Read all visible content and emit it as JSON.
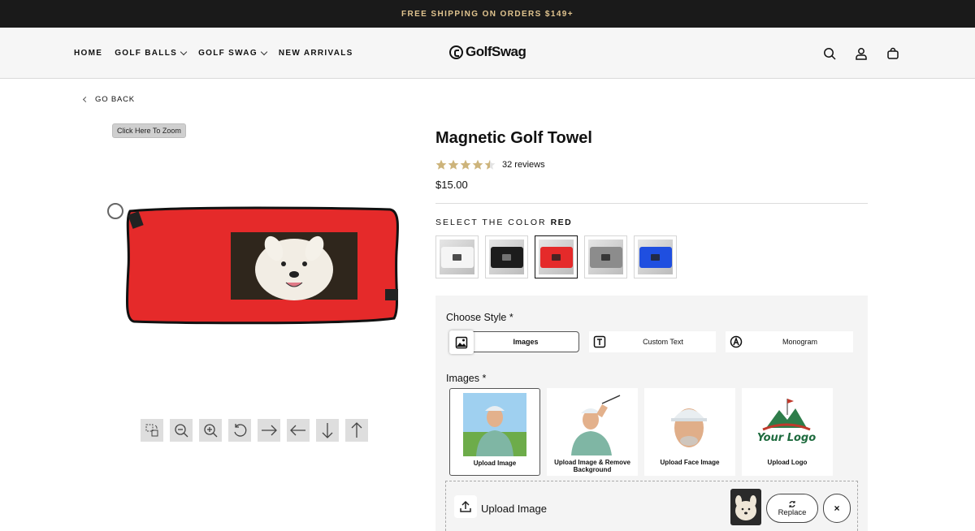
{
  "announcement": "FREE SHIPPING ON ORDERS $149+",
  "nav": {
    "home": "HOME",
    "golf_balls": "GOLF BALLS",
    "golf_swag": "GOLF SWAG",
    "new_arrivals": "NEW ARRIVALS"
  },
  "logo": "GolfSwag",
  "header_icons": [
    "search-icon",
    "account-icon",
    "cart-icon"
  ],
  "go_back": "GO BACK",
  "zoom_hint": "Click Here To Zoom",
  "product": {
    "title": "Magnetic Golf Towel",
    "rating": 4.5,
    "reviews": "32 reviews",
    "price": "$15.00",
    "color_label": "SELECT THE COLOR",
    "selected_color": "RED",
    "colors": [
      {
        "color": "#f5f5f5"
      },
      {
        "color": "#1c1c1c"
      },
      {
        "color": "#e52a2a"
      },
      {
        "color": "#8c8c8c"
      },
      {
        "color": "#1f4fe0"
      }
    ],
    "selected_index": 2
  },
  "style": {
    "label": "Choose Style *",
    "options": {
      "images": "Images",
      "custom_text": "Custom Text",
      "monogram": "Monogram"
    }
  },
  "images": {
    "label": "Images *",
    "options": {
      "upload": "Upload Image",
      "remove_bg": "Upload Image & Remove Background",
      "face": "Upload Face Image",
      "logo": "Upload Logo"
    },
    "logo_text": "Your Logo"
  },
  "upload": {
    "label": "Upload Image",
    "replace": "Replace",
    "remove": "×"
  },
  "colors": {
    "accent_gold": "#e0c48f",
    "towel_red": "#e52a2a"
  }
}
